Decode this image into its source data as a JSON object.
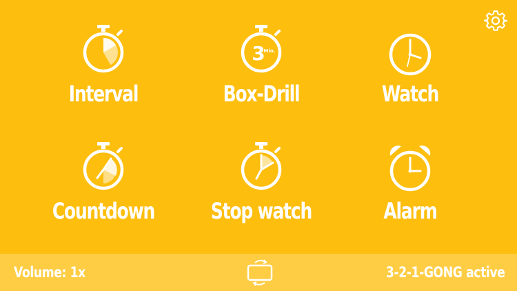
{
  "tiles": [
    {
      "id": "interval",
      "label": "Interval",
      "icon": "interval-stopwatch-icon"
    },
    {
      "id": "box-drill",
      "label": "Box-Drill",
      "icon": "box-drill-stopwatch-icon",
      "icon_text": "3",
      "icon_subtext": "Min."
    },
    {
      "id": "watch",
      "label": "Watch",
      "icon": "clock-icon"
    },
    {
      "id": "countdown",
      "label": "Countdown",
      "icon": "countdown-stopwatch-icon"
    },
    {
      "id": "stopwatch",
      "label": "Stop watch",
      "icon": "stopwatch-icon"
    },
    {
      "id": "alarm",
      "label": "Alarm",
      "icon": "alarm-clock-icon"
    }
  ],
  "footer": {
    "volume": "Volume: 1x",
    "gong": "3-2-1-GONG active",
    "rotate_icon": "rotate-device-icon"
  },
  "settings_icon": "gear-icon",
  "colors": {
    "background": "#FDBE0E",
    "footer": "#FECD44",
    "foreground": "#FFFFFF"
  }
}
